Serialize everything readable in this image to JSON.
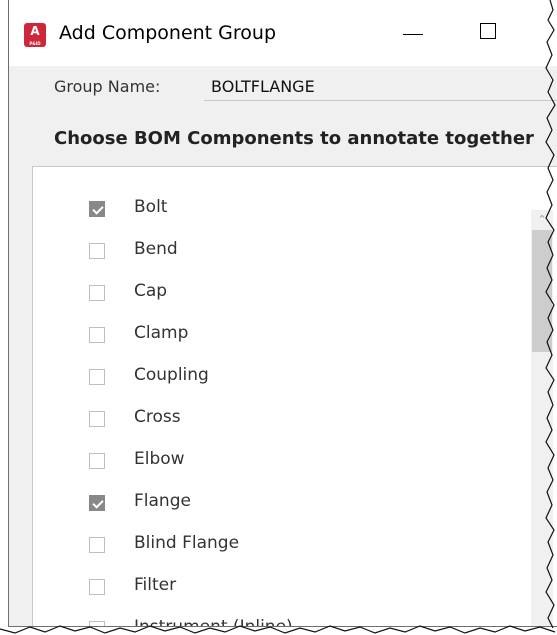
{
  "window": {
    "title": "Add Component Group",
    "icon_letter": "A",
    "icon_sub": "P&ID"
  },
  "form": {
    "group_name_label": "Group Name:",
    "group_name_value": "BOLTFLANGE",
    "section_title": "Choose BOM Components to annotate together"
  },
  "components": [
    {
      "label": "Bolt",
      "checked": true
    },
    {
      "label": "Bend",
      "checked": false
    },
    {
      "label": "Cap",
      "checked": false
    },
    {
      "label": "Clamp",
      "checked": false
    },
    {
      "label": "Coupling",
      "checked": false
    },
    {
      "label": "Cross",
      "checked": false
    },
    {
      "label": "Elbow",
      "checked": false
    },
    {
      "label": "Flange",
      "checked": true
    },
    {
      "label": "Blind Flange",
      "checked": false
    },
    {
      "label": "Filter",
      "checked": false
    },
    {
      "label": "Instrument (Inline)",
      "checked": false
    }
  ],
  "colors": {
    "app_icon": "#d0263a",
    "checkbox_checked": "#888888",
    "dialog_bg": "#f0f0f0"
  }
}
